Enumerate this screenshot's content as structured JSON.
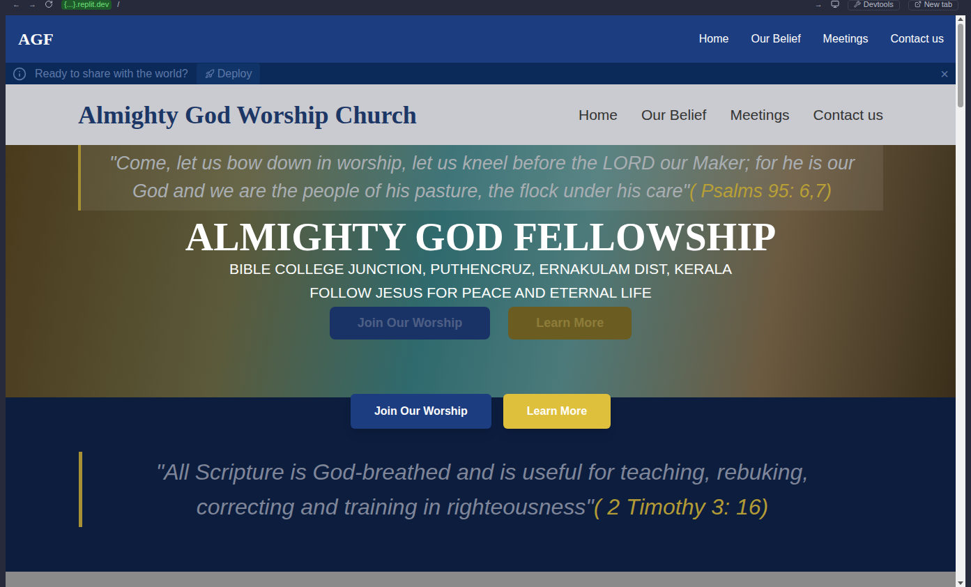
{
  "browser": {
    "back": "←",
    "forward": "→",
    "url_host": "{...}.replit.dev",
    "url_path": "/",
    "go": "→",
    "devtools": "Devtools",
    "new_tab": "New tab"
  },
  "site_nav": {
    "logo": "AGF",
    "links": [
      "Home",
      "Our Belief",
      "Meetings",
      "Contact us"
    ]
  },
  "banner": {
    "message": "Ready to share with the world?",
    "button": "Deploy",
    "close": "×"
  },
  "church_header": {
    "title": "Almighty God Worship Church",
    "links": [
      "Home",
      "Our Belief",
      "Meetings",
      "Contact us"
    ]
  },
  "hero": {
    "quote": "\"Come, let us bow down in worship, let us kneel before the LORD our Maker; for he is our God and we are the people of his pasture, the flock under his care\"",
    "citation": "( Psalms 95: 6,7)",
    "heading": "ALMIGHTY GOD FELLOWSHIP",
    "address": "BIBLE COLLEGE JUNCTION, PUTHENCRUZ, ERNAKULAM DIST, KERALA",
    "tagline": "FOLLOW JESUS FOR PEACE AND ETERNAL LIFE",
    "faded_buttons": [
      "Join Our Worship",
      "Learn More"
    ]
  },
  "actions": [
    "Join Our Worship",
    "Learn More"
  ],
  "scripture": {
    "quote": "\"All Scripture is God-breathed and is useful for teaching, rebuking, correcting and training in righteousness\"",
    "citation": "( 2 Timothy 3: 16)"
  }
}
